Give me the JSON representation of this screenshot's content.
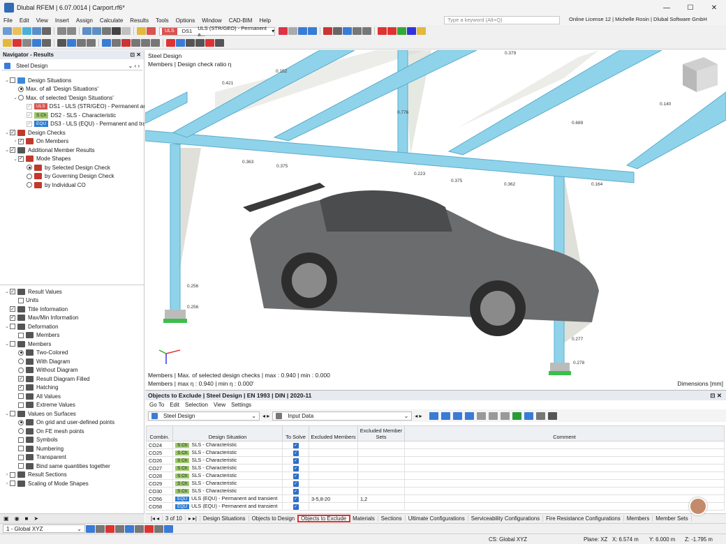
{
  "app": {
    "title": "Dlubal RFEM | 6.07.0014 | Carport.rf6*"
  },
  "menu": {
    "items": [
      "File",
      "Edit",
      "View",
      "Insert",
      "Assign",
      "Calculate",
      "Results",
      "Tools",
      "Options",
      "Window",
      "CAD-BIM",
      "Help"
    ],
    "search_placeholder": "Type a keyword (Alt+Q)",
    "license": "Online License 12 | Michelle Rosin | Dlubal Software GmbH"
  },
  "toolbar": {
    "ds_badge": "ULS",
    "ds_name": "DS1",
    "ds_desc": "ULS (STR/GEO) - Permanent a..."
  },
  "navigator": {
    "title": "Navigator - Results",
    "selector": "Steel Design",
    "tree_top": [
      {
        "label": "Design Situations",
        "indent": 0,
        "exp": "⌄",
        "ctrl": "cb",
        "state": "",
        "icon": "#3a8ad8"
      },
      {
        "label": "Max. of all 'Design Situations'",
        "indent": 1,
        "exp": "",
        "ctrl": "rd",
        "state": "on",
        "icon": ""
      },
      {
        "label": "Max. of selected 'Design Situations'",
        "indent": 1,
        "exp": "⌄",
        "ctrl": "rd",
        "state": "",
        "icon": ""
      },
      {
        "label": "DS1 - ULS (STR/GEO) - Permanent and...",
        "indent": 2,
        "exp": "",
        "ctrl": "cbd",
        "state": "✓",
        "badge": "ULS",
        "bcls": "b-uls"
      },
      {
        "label": "DS2 - SLS - Characteristic",
        "indent": 2,
        "exp": "",
        "ctrl": "cbd",
        "state": "✓",
        "badge": "S Ch",
        "bcls": "b-sch"
      },
      {
        "label": "DS3 - ULS (EQU) - Permanent and tran...",
        "indent": 2,
        "exp": "",
        "ctrl": "cbd",
        "state": "✓",
        "badge": "EQU",
        "bcls": "b-equ"
      },
      {
        "label": "Design Checks",
        "indent": 0,
        "exp": "⌄",
        "ctrl": "cb",
        "state": "✓",
        "icon": "#c0392b"
      },
      {
        "label": "On Members",
        "indent": 1,
        "exp": "›",
        "ctrl": "cb",
        "state": "✓",
        "icon": "#c0392b"
      },
      {
        "label": "Additional Member Results",
        "indent": 0,
        "exp": "⌄",
        "ctrl": "cb",
        "state": "✓",
        "icon": "#555"
      },
      {
        "label": "Mode Shapes",
        "indent": 1,
        "exp": "⌄",
        "ctrl": "cb",
        "state": "✓",
        "icon": "#c0392b"
      },
      {
        "label": "by Selected Design Check",
        "indent": 2,
        "exp": "",
        "ctrl": "rd",
        "state": "on",
        "icon": "#c0392b"
      },
      {
        "label": "by Governing Design Check",
        "indent": 2,
        "exp": "",
        "ctrl": "rd",
        "state": "",
        "icon": "#c0392b"
      },
      {
        "label": "by Individual CO",
        "indent": 2,
        "exp": "",
        "ctrl": "rd",
        "state": "",
        "icon": "#c0392b"
      }
    ],
    "tree_bottom": [
      {
        "label": "Result Values",
        "indent": 0,
        "exp": "⌄",
        "ctrl": "cb",
        "state": "✓",
        "icon": "#555"
      },
      {
        "label": "Units",
        "indent": 1,
        "exp": "",
        "ctrl": "cb",
        "state": "",
        "icon": ""
      },
      {
        "label": "Title Information",
        "indent": 0,
        "exp": "",
        "ctrl": "cb",
        "state": "✓",
        "icon": "#555"
      },
      {
        "label": "Max/Min Information",
        "indent": 0,
        "exp": "",
        "ctrl": "cb",
        "state": "✓",
        "icon": "#555"
      },
      {
        "label": "Deformation",
        "indent": 0,
        "exp": "⌄",
        "ctrl": "cb",
        "state": "",
        "icon": "#555"
      },
      {
        "label": "Members",
        "indent": 1,
        "exp": "",
        "ctrl": "cb",
        "state": "",
        "icon": "#555"
      },
      {
        "label": "Members",
        "indent": 0,
        "exp": "⌄",
        "ctrl": "cb",
        "state": "",
        "icon": "#555"
      },
      {
        "label": "Two-Colored",
        "indent": 1,
        "exp": "",
        "ctrl": "rd",
        "state": "on",
        "icon": "#555"
      },
      {
        "label": "With Diagram",
        "indent": 1,
        "exp": "",
        "ctrl": "rd",
        "state": "",
        "icon": "#555"
      },
      {
        "label": "Without Diagram",
        "indent": 1,
        "exp": "",
        "ctrl": "rd",
        "state": "",
        "icon": "#555"
      },
      {
        "label": "Result Diagram Filled",
        "indent": 1,
        "exp": "",
        "ctrl": "cb",
        "state": "✓",
        "icon": "#555"
      },
      {
        "label": "Hatching",
        "indent": 1,
        "exp": "",
        "ctrl": "cb",
        "state": "✓",
        "icon": "#555"
      },
      {
        "label": "All Values",
        "indent": 1,
        "exp": "",
        "ctrl": "cb",
        "state": "",
        "icon": "#555"
      },
      {
        "label": "Extreme Values",
        "indent": 1,
        "exp": "",
        "ctrl": "cb",
        "state": "",
        "icon": "#555"
      },
      {
        "label": "Values on Surfaces",
        "indent": 0,
        "exp": "⌄",
        "ctrl": "cb",
        "state": "",
        "icon": "#555"
      },
      {
        "label": "On grid and user-defined points",
        "indent": 1,
        "exp": "",
        "ctrl": "rd",
        "state": "on",
        "icon": "#555"
      },
      {
        "label": "On FE mesh points",
        "indent": 1,
        "exp": "",
        "ctrl": "rd",
        "state": "",
        "icon": "#555"
      },
      {
        "label": "Symbols",
        "indent": 1,
        "exp": "",
        "ctrl": "cb",
        "state": "",
        "icon": "#555"
      },
      {
        "label": "Numbering",
        "indent": 1,
        "exp": "",
        "ctrl": "cb",
        "state": "",
        "icon": "#555"
      },
      {
        "label": "Transparent",
        "indent": 1,
        "exp": "",
        "ctrl": "cb",
        "state": "",
        "icon": "#555"
      },
      {
        "label": "Bind same quantities together",
        "indent": 1,
        "exp": "",
        "ctrl": "cb",
        "state": "",
        "icon": "#555"
      },
      {
        "label": "Result Sections",
        "indent": 0,
        "exp": "›",
        "ctrl": "cb",
        "state": "",
        "icon": "#555"
      },
      {
        "label": "Scaling of Mode Shapes",
        "indent": 0,
        "exp": "›",
        "ctrl": "cb",
        "state": "",
        "icon": "#555"
      }
    ]
  },
  "viewport": {
    "title": "Steel Design",
    "subtitle": "Members | Design check ratio η",
    "footer1": "Members | Max. of selected design checks | max  : 0.940 | min  : 0.000",
    "footer2": "Members | max η : 0.940 | min η : 0.000'",
    "dims": "Dimensions [mm]",
    "values": [
      "0.379",
      "0.152",
      "0.421",
      "0.140",
      "0.776",
      "0.689",
      "0.363",
      "0.375",
      "0.223",
      "0.375",
      "0.362",
      "0.164",
      "0.256",
      "0.256",
      "0.277",
      "0.278"
    ]
  },
  "results": {
    "title": "Objects to Exclude | Steel Design | EN 1993 | DIN | 2020-11",
    "menu": [
      "Go To",
      "Edit",
      "Selection",
      "View",
      "Settings"
    ],
    "module": "Steel Design",
    "input": "Input Data",
    "headers": [
      "Combin.",
      "Design Situation",
      "To Solve",
      "Excluded Members",
      "Excluded Member Sets",
      "Comment"
    ],
    "rows": [
      {
        "co": "CO24",
        "badge": "S Ch",
        "ds": "SLS - Characteristic",
        "members": "",
        "sets": ""
      },
      {
        "co": "CO25",
        "badge": "S Ch",
        "ds": "SLS - Characteristic",
        "members": "",
        "sets": ""
      },
      {
        "co": "CO26",
        "badge": "S Ch",
        "ds": "SLS - Characteristic",
        "members": "",
        "sets": ""
      },
      {
        "co": "CO27",
        "badge": "S Ch",
        "ds": "SLS - Characteristic",
        "members": "",
        "sets": ""
      },
      {
        "co": "CO28",
        "badge": "S Ch",
        "ds": "SLS - Characteristic",
        "members": "",
        "sets": ""
      },
      {
        "co": "CO29",
        "badge": "S Ch",
        "ds": "SLS - Characteristic",
        "members": "",
        "sets": ""
      },
      {
        "co": "CO30",
        "badge": "S Ch",
        "ds": "SLS - Characteristic",
        "members": "",
        "sets": ""
      },
      {
        "co": "CO56",
        "badge": "EQU",
        "ds": "ULS (EQU) - Permanent and transient",
        "members": "3-5,8-20",
        "sets": "1,2"
      },
      {
        "co": "CO58",
        "badge": "EQU",
        "ds": "ULS (EQU) - Permanent and transient",
        "members": "",
        "sets": ""
      }
    ],
    "pager": "3 of 10",
    "tabs": [
      "Design Situations",
      "Objects to Design",
      "Objects to Exclude",
      "Materials",
      "Sections",
      "Ultimate Configurations",
      "Serviceability Configurations",
      "Fire Resistance Configurations",
      "Members",
      "Member Sets"
    ],
    "active_tab": "Objects to Exclude"
  },
  "statusbar": {
    "coord_system": "1 - Global XYZ",
    "cs": "CS: Global XYZ",
    "plane": "Plane: XZ",
    "x": "X: 6.574 m",
    "y": "Y: 6.000 m",
    "z": "Z: -1.795 m"
  }
}
